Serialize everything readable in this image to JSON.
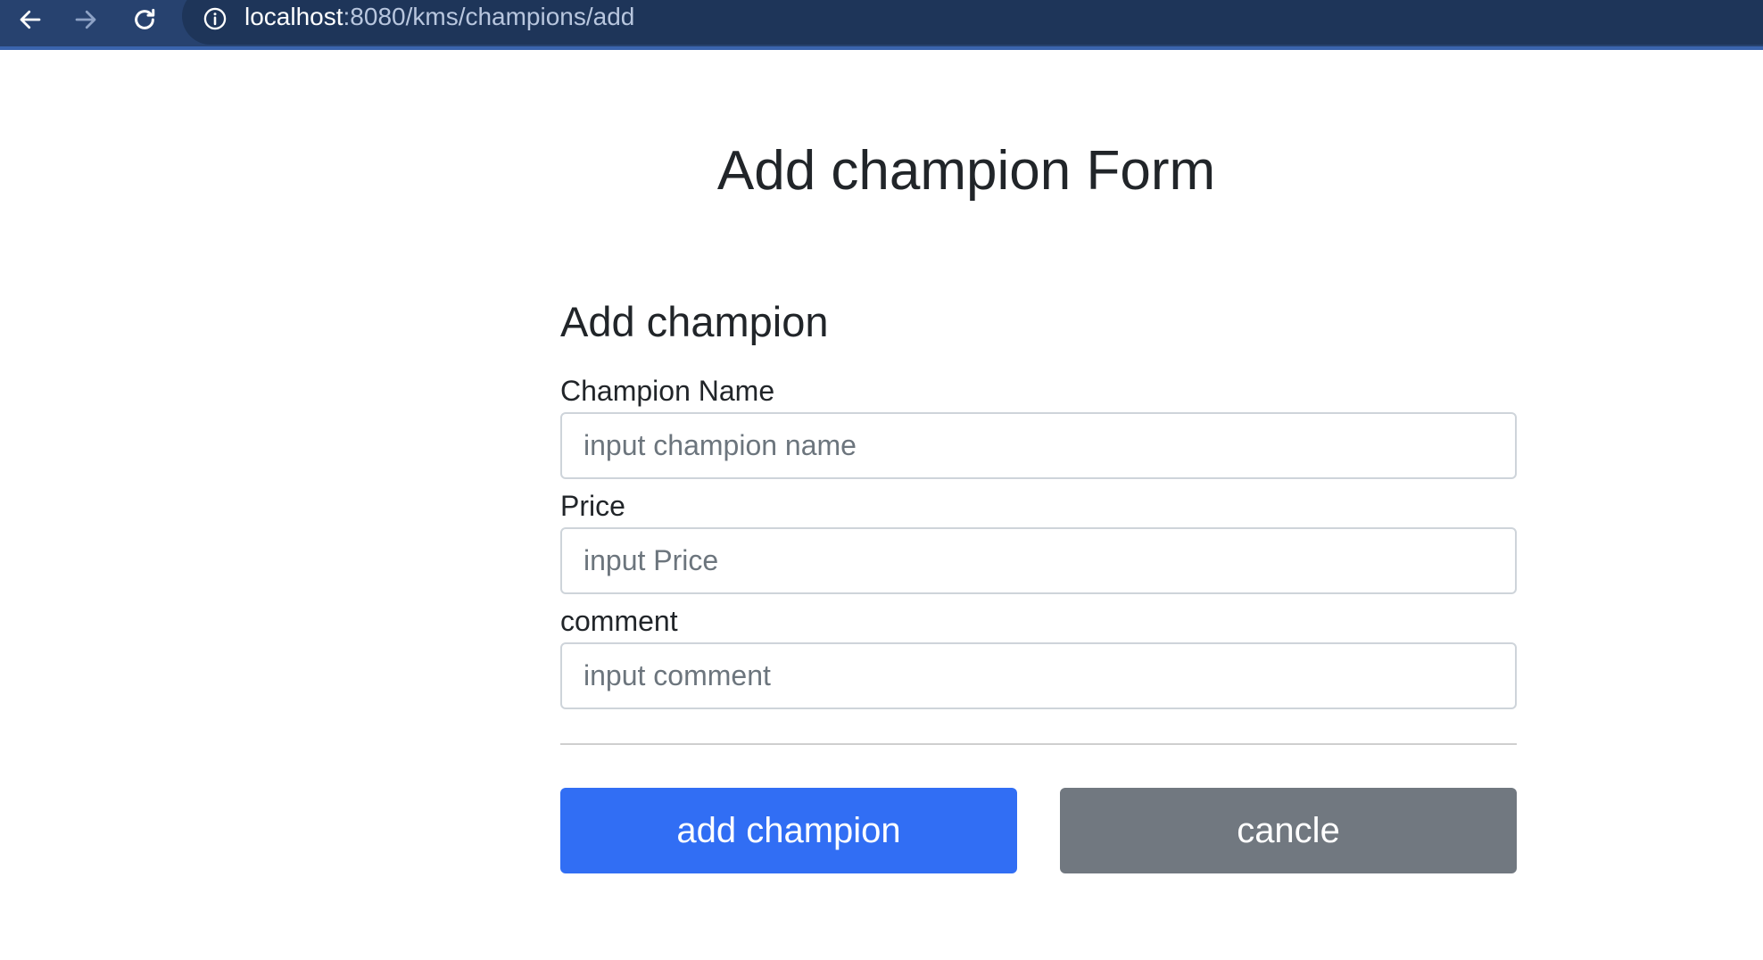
{
  "browser": {
    "url_host": "localhost",
    "url_path": ":8080/kms/champions/add",
    "icons": {
      "back": "arrow-left-icon",
      "forward": "arrow-right-icon",
      "reload": "reload-icon",
      "site_info": "info-icon"
    }
  },
  "page": {
    "title": "Add champion Form"
  },
  "form": {
    "heading": "Add champion",
    "fields": [
      {
        "label": "Champion Name",
        "placeholder": "input champion name",
        "value": ""
      },
      {
        "label": "Price",
        "placeholder": "input Price",
        "value": ""
      },
      {
        "label": "comment",
        "placeholder": "input comment",
        "value": ""
      }
    ],
    "submit_label": "add champion",
    "cancel_label": "cancle"
  },
  "colors": {
    "primary": "#316ef4",
    "secondary": "#717880",
    "browser_bar": "#27426f"
  }
}
